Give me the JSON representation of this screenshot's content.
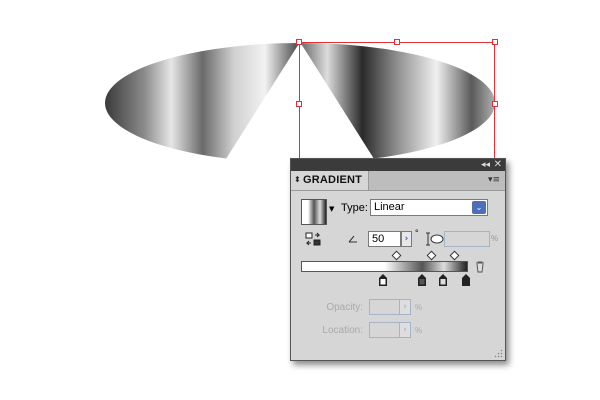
{
  "panel": {
    "tab_label": "GRADIENT",
    "type_label": "Type:",
    "type_value": "Linear",
    "angle_value": "50",
    "degree_symbol": "°",
    "percent_unit": "%",
    "opacity_label": "Opacity:",
    "location_label": "Location:",
    "collapse_glyph": "◂◂",
    "close_glyph": "✕",
    "menu_glyph": "▾≡"
  },
  "icons": [
    "reverse-gradient-icon",
    "angle-icon",
    "aspect-ratio-icon",
    "trash-icon",
    "panel-menu-icon",
    "resize-grip-icon"
  ],
  "colors": {
    "selection": "#e0303a",
    "panel_bg": "#d6d6d6",
    "titlebar": "#3b3b3b",
    "dropdown_blue": "#4d6fb8"
  }
}
